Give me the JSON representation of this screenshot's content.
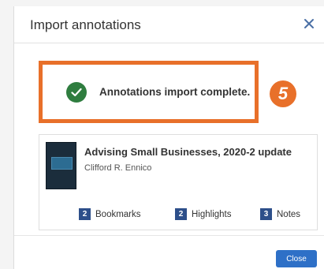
{
  "dialog": {
    "title": "Import annotations",
    "close_icon": "close-icon"
  },
  "status": {
    "icon": "check-circle-icon",
    "message": "Annotations import complete.",
    "step_number": "5",
    "accent_color": "#e8702a"
  },
  "book": {
    "title": "Advising Small Businesses, 2020-2 update",
    "author": "Clifford R. Ennico",
    "counts": [
      {
        "count": "2",
        "label": "Bookmarks"
      },
      {
        "count": "2",
        "label": "Highlights"
      },
      {
        "count": "3",
        "label": "Notes"
      }
    ]
  },
  "footer": {
    "close_label": "Close"
  }
}
